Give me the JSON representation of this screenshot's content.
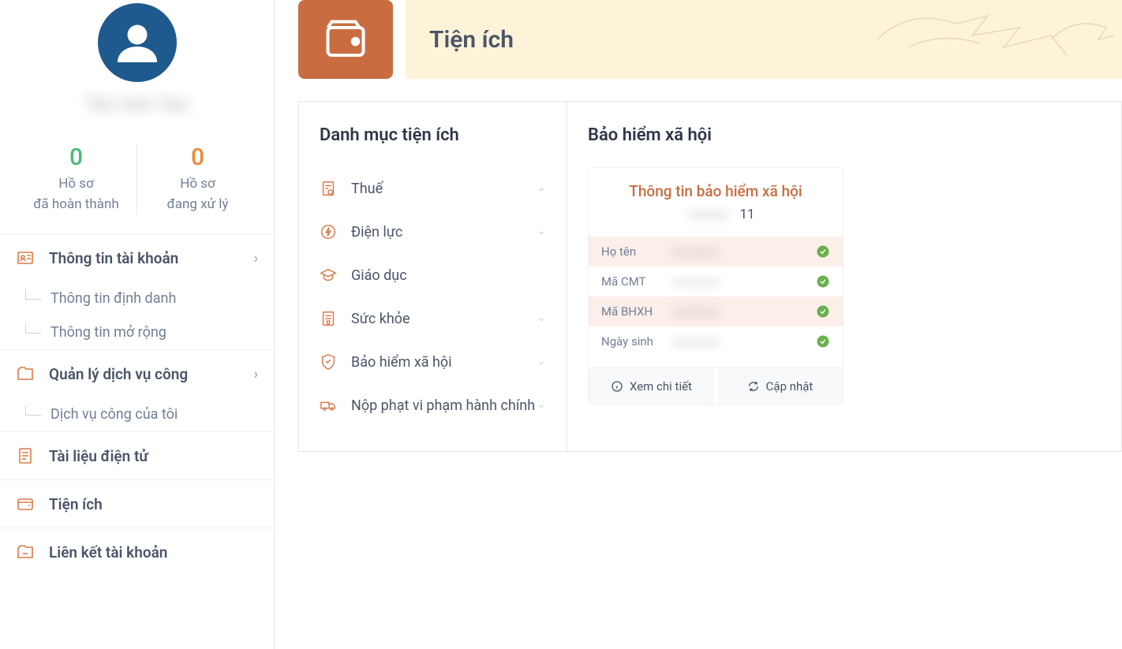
{
  "profile": {
    "username": "Ten Van Tao"
  },
  "stats": {
    "completed": {
      "value": "0",
      "label": "Hồ sơ\nđã hoàn thành"
    },
    "processing": {
      "value": "0",
      "label": "Hồ sơ\nđang xử lý"
    }
  },
  "nav": {
    "account": {
      "label": "Thông tin tài khoản"
    },
    "account_sub1": {
      "label": "Thông tin định danh"
    },
    "account_sub2": {
      "label": "Thông tin mở rộng"
    },
    "services": {
      "label": "Quản lý dịch vụ công"
    },
    "services_sub1": {
      "label": "Dịch vụ công của tôi"
    },
    "docs": {
      "label": "Tài liệu điện tử"
    },
    "utilities": {
      "label": "Tiện ích"
    },
    "linked": {
      "label": "Liên kết tài khoản"
    }
  },
  "header": {
    "title": "Tiện ích"
  },
  "categories": {
    "title": "Danh mục tiện ích",
    "tax": "Thuế",
    "electricity": "Điện lực",
    "education": "Giáo dục",
    "health": "Sức khỏe",
    "social_insurance": "Bảo hiểm xã hội",
    "fines": "Nộp phạt vi phạm hành chính"
  },
  "detail": {
    "title": "Bảo hiểm xã hội",
    "card_title": "Thông tin bảo hiểm xã hội",
    "card_sub_suffix": "11",
    "rows": {
      "name": {
        "key": "Họ tên",
        "val": "xxxxxxxx"
      },
      "cmt": {
        "key": "Mã CMT",
        "val": "xxxxxxxx"
      },
      "bhxh": {
        "key": "Mã BHXH",
        "val": "xxxxxxxx"
      },
      "dob": {
        "key": "Ngày sinh",
        "val": "xxxxxxxx"
      }
    },
    "actions": {
      "view": "Xem chi tiết",
      "update": "Cập nhật"
    }
  }
}
